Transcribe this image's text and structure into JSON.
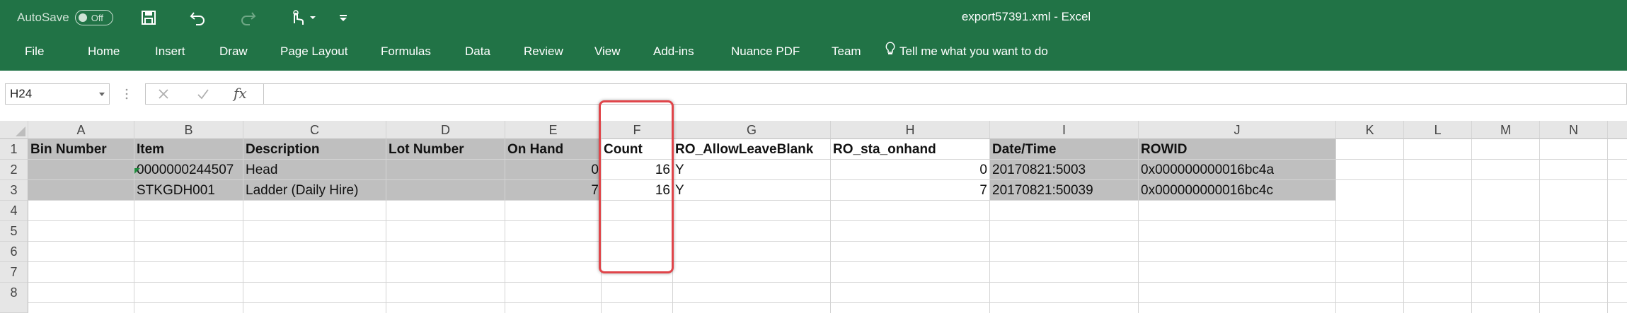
{
  "titlebar": {
    "autosave_label": "AutoSave",
    "autosave_state": "Off",
    "window_title": "export57391.xml  -  Excel",
    "icons": [
      "save-icon",
      "undo-icon",
      "redo-icon",
      "touch-mode-icon",
      "customize-qat-icon"
    ]
  },
  "ribbon": {
    "tabs": [
      "File",
      "Home",
      "Insert",
      "Draw",
      "Page Layout",
      "Formulas",
      "Data",
      "Review",
      "View",
      "Add-ins",
      "Nuance PDF",
      "Team"
    ],
    "tell_me": "Tell me what you want to do"
  },
  "formula_bar": {
    "name_box": "H24",
    "fx_label": "fx",
    "formula": ""
  },
  "sheet": {
    "columns": [
      "A",
      "B",
      "C",
      "D",
      "E",
      "F",
      "G",
      "H",
      "I",
      "J",
      "K",
      "L",
      "M",
      "N"
    ],
    "rows": [
      "1",
      "2",
      "3",
      "4",
      "5",
      "6",
      "7",
      "8"
    ],
    "header_row": [
      "Bin Number",
      "Item",
      "Description",
      "Lot Number",
      "On Hand",
      "Count",
      "RO_AllowLeaveBlank",
      "RO_sta_onhand",
      "Date/Time",
      "ROWID"
    ],
    "data_rows": [
      [
        "",
        "0000000244507",
        "Head",
        "",
        "0",
        "16",
        "Y",
        "0",
        "20170821:5003",
        "0x000000000016bc4a"
      ],
      [
        "",
        "STKGDH001",
        "Ladder (Daily Hire)",
        "",
        "7",
        "16",
        "Y",
        "7",
        "20170821:50039",
        "0x000000000016bc4c"
      ]
    ],
    "highlighted_column": "F",
    "highlight_color": "#e0454a",
    "accent_color": "#217346"
  }
}
